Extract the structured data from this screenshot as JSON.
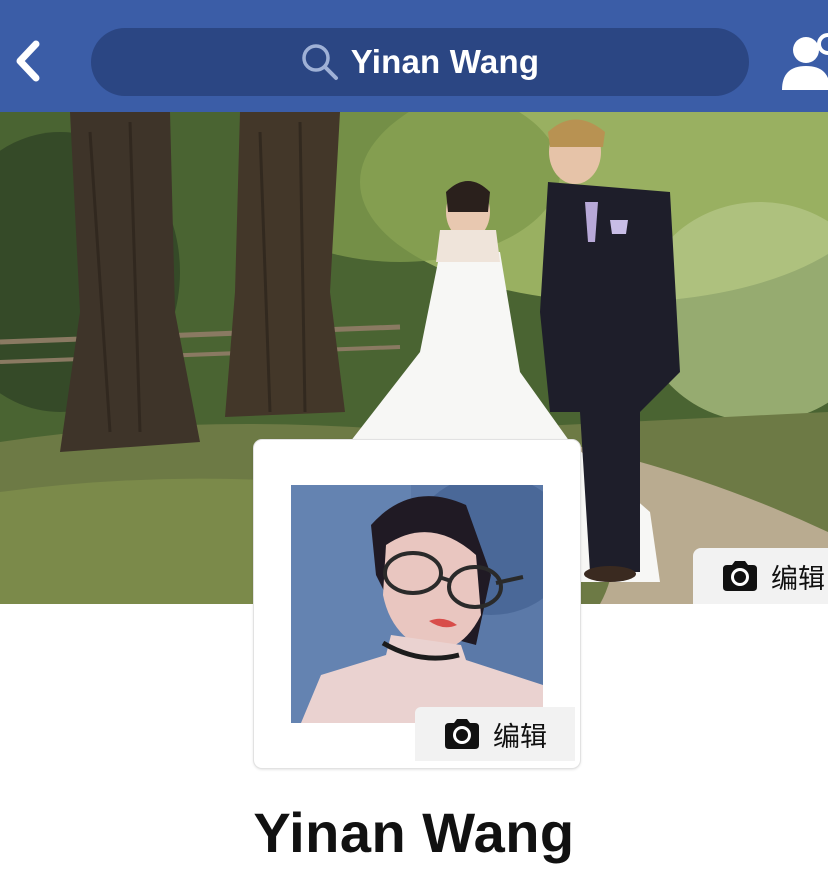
{
  "header": {
    "search_text": "Yinan Wang",
    "bar_color": "#3b5da7",
    "search_bg": "#2b4683",
    "back_icon": "chevron-left-icon",
    "search_icon": "magnifier-icon",
    "friends_icon": "friends-icon"
  },
  "cover": {
    "edit_label": "编辑",
    "edit_icon": "camera-icon"
  },
  "avatar": {
    "edit_label": "编辑",
    "edit_icon": "camera-icon"
  },
  "profile": {
    "name": "Yinan Wang"
  }
}
